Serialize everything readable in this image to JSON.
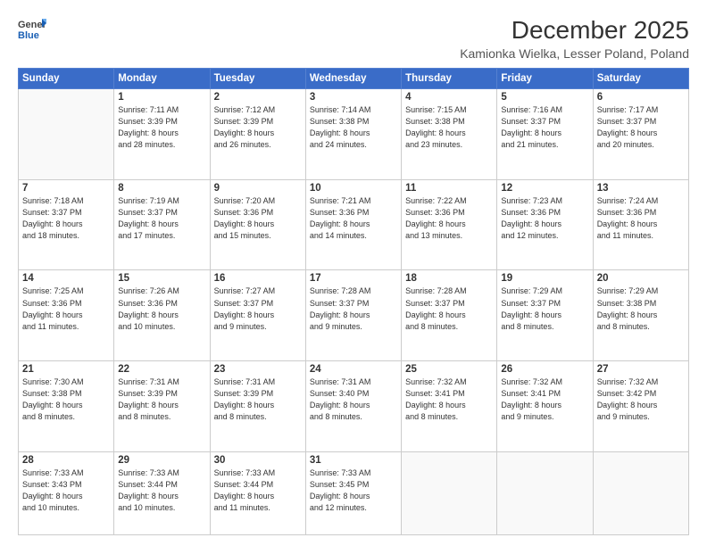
{
  "header": {
    "logo_line1": "General",
    "logo_line2": "Blue",
    "month": "December 2025",
    "location": "Kamionka Wielka, Lesser Poland, Poland"
  },
  "weekdays": [
    "Sunday",
    "Monday",
    "Tuesday",
    "Wednesday",
    "Thursday",
    "Friday",
    "Saturday"
  ],
  "weeks": [
    [
      {
        "day": "",
        "info": ""
      },
      {
        "day": "1",
        "info": "Sunrise: 7:11 AM\nSunset: 3:39 PM\nDaylight: 8 hours\nand 28 minutes."
      },
      {
        "day": "2",
        "info": "Sunrise: 7:12 AM\nSunset: 3:39 PM\nDaylight: 8 hours\nand 26 minutes."
      },
      {
        "day": "3",
        "info": "Sunrise: 7:14 AM\nSunset: 3:38 PM\nDaylight: 8 hours\nand 24 minutes."
      },
      {
        "day": "4",
        "info": "Sunrise: 7:15 AM\nSunset: 3:38 PM\nDaylight: 8 hours\nand 23 minutes."
      },
      {
        "day": "5",
        "info": "Sunrise: 7:16 AM\nSunset: 3:37 PM\nDaylight: 8 hours\nand 21 minutes."
      },
      {
        "day": "6",
        "info": "Sunrise: 7:17 AM\nSunset: 3:37 PM\nDaylight: 8 hours\nand 20 minutes."
      }
    ],
    [
      {
        "day": "7",
        "info": "Sunrise: 7:18 AM\nSunset: 3:37 PM\nDaylight: 8 hours\nand 18 minutes."
      },
      {
        "day": "8",
        "info": "Sunrise: 7:19 AM\nSunset: 3:37 PM\nDaylight: 8 hours\nand 17 minutes."
      },
      {
        "day": "9",
        "info": "Sunrise: 7:20 AM\nSunset: 3:36 PM\nDaylight: 8 hours\nand 15 minutes."
      },
      {
        "day": "10",
        "info": "Sunrise: 7:21 AM\nSunset: 3:36 PM\nDaylight: 8 hours\nand 14 minutes."
      },
      {
        "day": "11",
        "info": "Sunrise: 7:22 AM\nSunset: 3:36 PM\nDaylight: 8 hours\nand 13 minutes."
      },
      {
        "day": "12",
        "info": "Sunrise: 7:23 AM\nSunset: 3:36 PM\nDaylight: 8 hours\nand 12 minutes."
      },
      {
        "day": "13",
        "info": "Sunrise: 7:24 AM\nSunset: 3:36 PM\nDaylight: 8 hours\nand 11 minutes."
      }
    ],
    [
      {
        "day": "14",
        "info": "Sunrise: 7:25 AM\nSunset: 3:36 PM\nDaylight: 8 hours\nand 11 minutes."
      },
      {
        "day": "15",
        "info": "Sunrise: 7:26 AM\nSunset: 3:36 PM\nDaylight: 8 hours\nand 10 minutes."
      },
      {
        "day": "16",
        "info": "Sunrise: 7:27 AM\nSunset: 3:37 PM\nDaylight: 8 hours\nand 9 minutes."
      },
      {
        "day": "17",
        "info": "Sunrise: 7:28 AM\nSunset: 3:37 PM\nDaylight: 8 hours\nand 9 minutes."
      },
      {
        "day": "18",
        "info": "Sunrise: 7:28 AM\nSunset: 3:37 PM\nDaylight: 8 hours\nand 8 minutes."
      },
      {
        "day": "19",
        "info": "Sunrise: 7:29 AM\nSunset: 3:37 PM\nDaylight: 8 hours\nand 8 minutes."
      },
      {
        "day": "20",
        "info": "Sunrise: 7:29 AM\nSunset: 3:38 PM\nDaylight: 8 hours\nand 8 minutes."
      }
    ],
    [
      {
        "day": "21",
        "info": "Sunrise: 7:30 AM\nSunset: 3:38 PM\nDaylight: 8 hours\nand 8 minutes."
      },
      {
        "day": "22",
        "info": "Sunrise: 7:31 AM\nSunset: 3:39 PM\nDaylight: 8 hours\nand 8 minutes."
      },
      {
        "day": "23",
        "info": "Sunrise: 7:31 AM\nSunset: 3:39 PM\nDaylight: 8 hours\nand 8 minutes."
      },
      {
        "day": "24",
        "info": "Sunrise: 7:31 AM\nSunset: 3:40 PM\nDaylight: 8 hours\nand 8 minutes."
      },
      {
        "day": "25",
        "info": "Sunrise: 7:32 AM\nSunset: 3:41 PM\nDaylight: 8 hours\nand 8 minutes."
      },
      {
        "day": "26",
        "info": "Sunrise: 7:32 AM\nSunset: 3:41 PM\nDaylight: 8 hours\nand 9 minutes."
      },
      {
        "day": "27",
        "info": "Sunrise: 7:32 AM\nSunset: 3:42 PM\nDaylight: 8 hours\nand 9 minutes."
      }
    ],
    [
      {
        "day": "28",
        "info": "Sunrise: 7:33 AM\nSunset: 3:43 PM\nDaylight: 8 hours\nand 10 minutes."
      },
      {
        "day": "29",
        "info": "Sunrise: 7:33 AM\nSunset: 3:44 PM\nDaylight: 8 hours\nand 10 minutes."
      },
      {
        "day": "30",
        "info": "Sunrise: 7:33 AM\nSunset: 3:44 PM\nDaylight: 8 hours\nand 11 minutes."
      },
      {
        "day": "31",
        "info": "Sunrise: 7:33 AM\nSunset: 3:45 PM\nDaylight: 8 hours\nand 12 minutes."
      },
      {
        "day": "",
        "info": ""
      },
      {
        "day": "",
        "info": ""
      },
      {
        "day": "",
        "info": ""
      }
    ]
  ]
}
